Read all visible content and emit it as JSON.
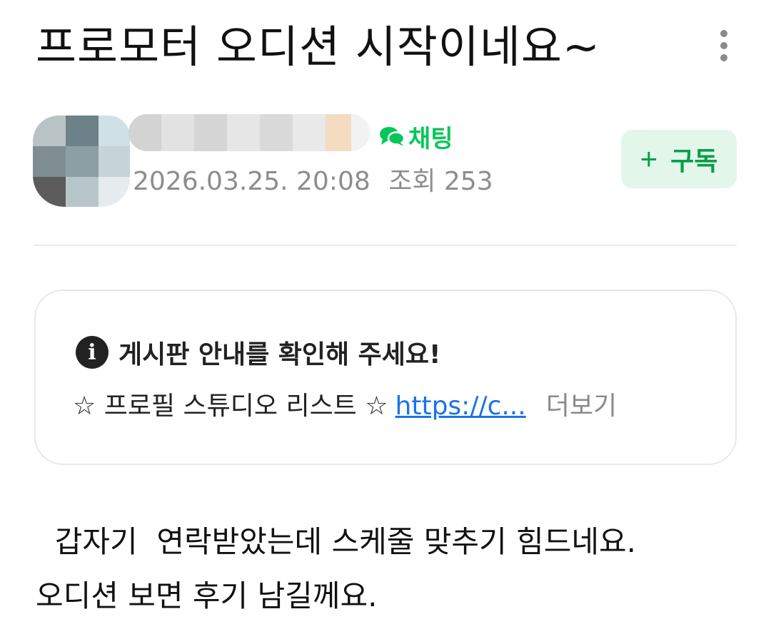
{
  "post": {
    "title": "프로모터 오디션 시작이네요~",
    "more_icon": "more-vertical-icon"
  },
  "author": {
    "chat_label": "채팅",
    "chat_icon": "chat-bubble-icon",
    "date": "2026.03.25. 20:08",
    "views": "조회 253",
    "subscribe_label": "구독",
    "subscribe_icon": "plus-icon"
  },
  "notice": {
    "icon": "info-icon",
    "heading": "게시판 안내를 확인해 주세요!",
    "line_text": "☆ 프로필 스튜디오 리스트 ☆",
    "link_text": "https://c...",
    "more_label": "더보기"
  },
  "body": {
    "line1": "  갑자기  연락받았는데 스케줄 맞추기 힘드네요.",
    "line2": "오디션 보면 후기 남길께요."
  },
  "colors": {
    "accent_green": "#03c75a",
    "subscribe_bg": "#e3f6ea",
    "link_blue": "#1a73e8",
    "meta_gray": "#8d8d8d"
  }
}
